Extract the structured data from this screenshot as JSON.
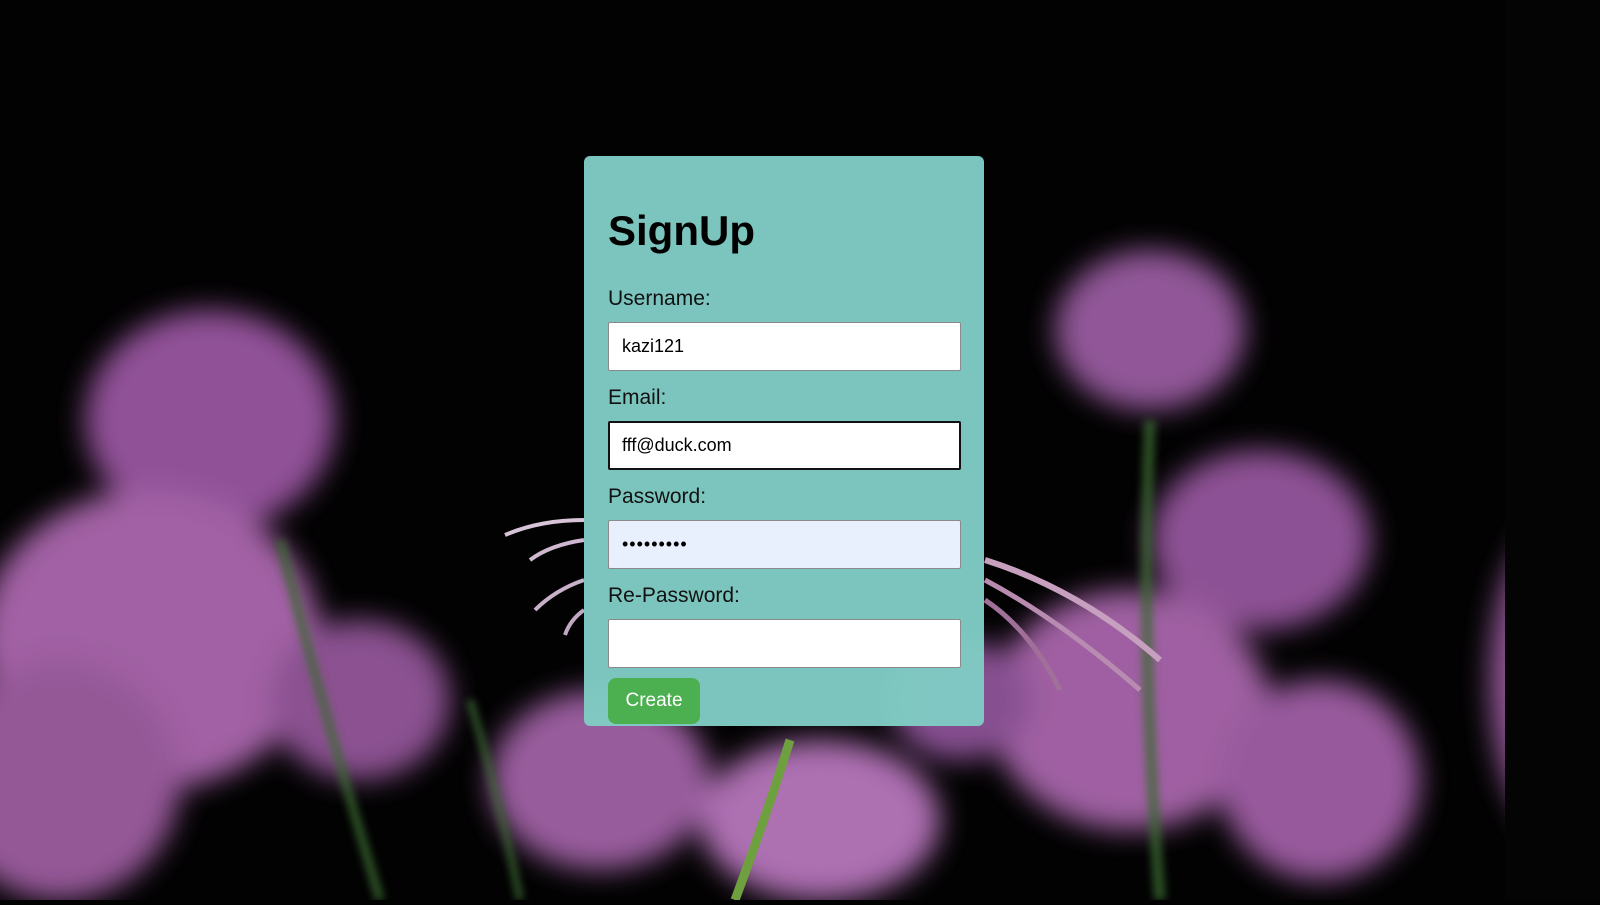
{
  "form": {
    "title": "SignUp",
    "username_label": "Username:",
    "username_value": "kazi121",
    "email_label": "Email:",
    "email_value": "fff@duck.com",
    "password_label": "Password:",
    "password_value": "123456789",
    "repassword_label": "Re-Password:",
    "repassword_value": "",
    "create_label": "Create"
  },
  "colors": {
    "card_background": "#80cbc4",
    "button_background": "#4caf50",
    "autofill_background": "#e8f0fe",
    "page_background": "#020202"
  }
}
